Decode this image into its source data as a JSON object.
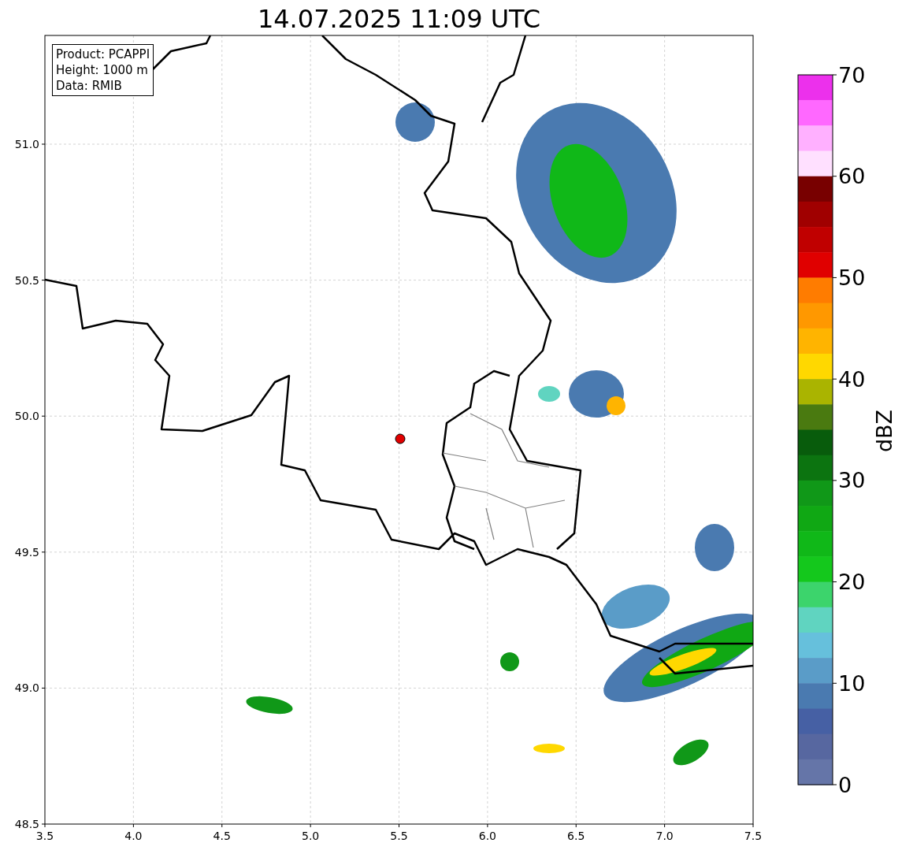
{
  "title": "14.07.2025 11:09 UTC",
  "info_box": [
    "Product: PCAPPI",
    "Height: 1000 m",
    "Data: RMIB"
  ],
  "map": {
    "x_ticks": [
      "3.5",
      "4.0",
      "4.5",
      "5.0",
      "5.5",
      "6.0",
      "6.5",
      "7.0",
      "7.5"
    ],
    "y_ticks": [
      "51.0",
      "50.5",
      "50.0",
      "49.5",
      "49.0",
      "48.5"
    ]
  },
  "colorbar": {
    "label": "dBZ",
    "ticks": [
      "70",
      "60",
      "50",
      "40",
      "30",
      "20",
      "10",
      "0"
    ],
    "segments": [
      {
        "color": "#ec30ec"
      },
      {
        "color": "#ff68ff"
      },
      {
        "color": "#ffb0ff"
      },
      {
        "color": "#ffe0ff"
      },
      {
        "color": "#780000"
      },
      {
        "color": "#a00000"
      },
      {
        "color": "#c00000"
      },
      {
        "color": "#e00000"
      },
      {
        "color": "#ff7c00"
      },
      {
        "color": "#ff9800"
      },
      {
        "color": "#ffb400"
      },
      {
        "color": "#ffd800"
      },
      {
        "color": "#aab400"
      },
      {
        "color": "#4a7a10"
      },
      {
        "color": "#085c0c"
      },
      {
        "color": "#0c7410"
      },
      {
        "color": "#109818"
      },
      {
        "color": "#10a814"
      },
      {
        "color": "#10b818"
      },
      {
        "color": "#14c81c"
      },
      {
        "color": "#3cd46c"
      },
      {
        "color": "#60d4c0"
      },
      {
        "color": "#66c0dc"
      },
      {
        "color": "#5a9cc8"
      },
      {
        "color": "#4a7ab0"
      },
      {
        "color": "#4660a4"
      },
      {
        "color": "#5767a0"
      },
      {
        "color": "#6575a8"
      }
    ]
  }
}
